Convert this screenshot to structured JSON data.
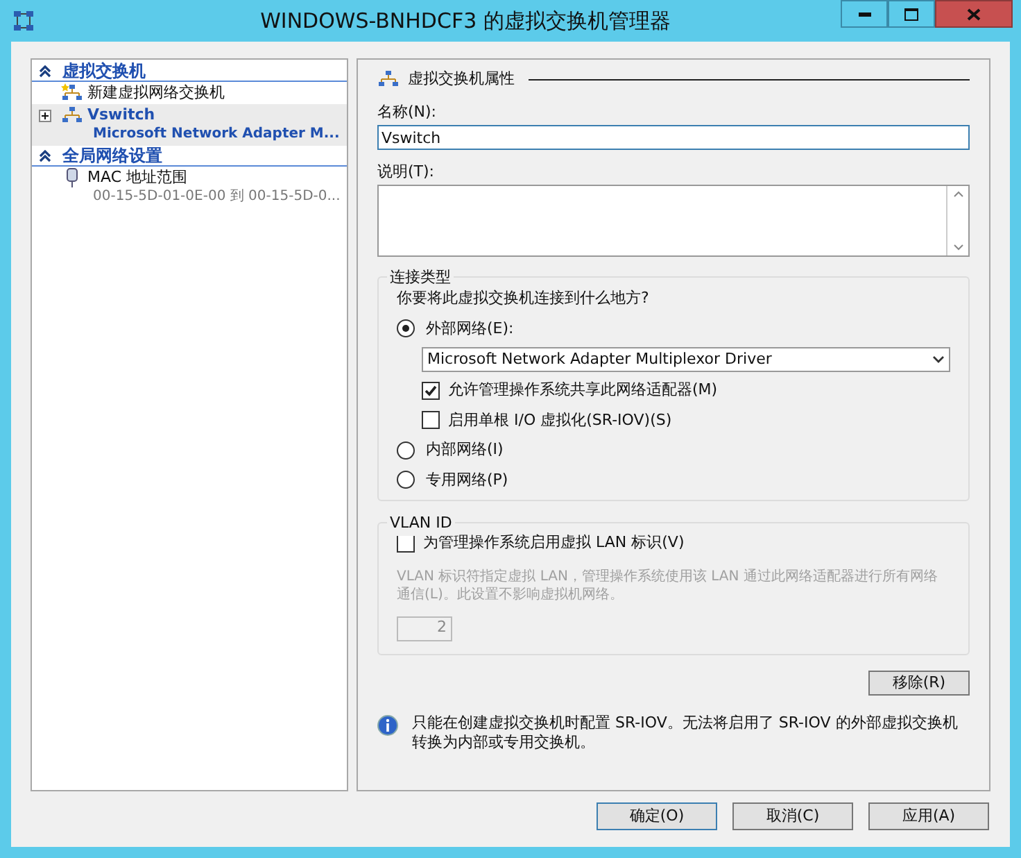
{
  "window": {
    "title": "WINDOWS-BNHDCF3 的虚拟交换机管理器"
  },
  "sidebar": {
    "sections": [
      {
        "title": "虚拟交换机",
        "expanded": true,
        "items": [
          {
            "kind": "new",
            "label": "新建虚拟网络交换机",
            "selected": false
          },
          {
            "kind": "switch",
            "label": "Vswitch",
            "detail": "Microsoft Network Adapter M...",
            "selected": true,
            "expanded": false
          }
        ]
      },
      {
        "title": "全局网络设置",
        "expanded": true,
        "items": [
          {
            "kind": "mac",
            "label": "MAC 地址范围",
            "detail": "00-15-5D-01-0E-00 到 00-15-5D-0...",
            "selected": false
          }
        ]
      }
    ]
  },
  "properties": {
    "title": "虚拟交换机属性",
    "name_label": "名称(N):",
    "name_value": "Vswitch",
    "description_label": "说明(T):",
    "connection": {
      "legend": "连接类型",
      "question": "你要将此虚拟交换机连接到什么地方?",
      "options": [
        {
          "kind": "external",
          "label": "外部网络(E):",
          "selected": true,
          "adapter": "Microsoft Network Adapter Multiplexor Driver",
          "checkboxes": [
            {
              "label": "允许管理操作系统共享此网络适配器(M)",
              "checked": true
            },
            {
              "label": "启用单根 I/O 虚拟化(SR-IOV)(S)",
              "checked": false
            }
          ]
        },
        {
          "kind": "plain",
          "label": "内部网络(I)",
          "selected": false
        },
        {
          "kind": "plain",
          "label": "专用网络(P)",
          "selected": false
        }
      ]
    },
    "vlan": {
      "legend": "VLAN ID",
      "checkbox": {
        "label": "为管理操作系统启用虚拟 LAN 标识(V)",
        "checked": false
      },
      "description": "VLAN 标识符指定虚拟 LAN，管理操作系统使用该 LAN 通过此网络适配器进行所有网络通信(L)。此设置不影响虚拟机网络。",
      "value": "2"
    },
    "remove_button": "移除(R)",
    "info": "只能在创建虚拟交换机时配置 SR-IOV。无法将启用了 SR-IOV 的外部虚拟交换机转换为内部或专用交换机。"
  },
  "buttons": [
    {
      "label": "确定(O)",
      "default": true
    },
    {
      "label": "取消(C)",
      "default": false
    },
    {
      "label": "应用(A)",
      "default": false
    }
  ]
}
